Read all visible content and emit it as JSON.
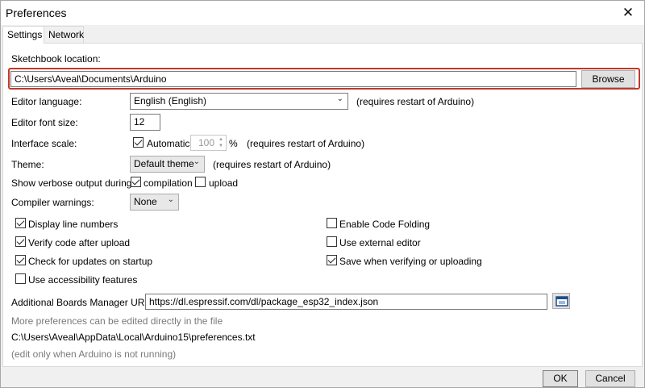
{
  "window": {
    "title": "Preferences",
    "close_glyph": "✕"
  },
  "tabs": [
    {
      "label": "Settings"
    },
    {
      "label": "Network"
    }
  ],
  "sketchbook": {
    "label": "Sketchbook location:",
    "value": "C:\\Users\\Aveal\\Documents\\Arduino",
    "browse_label": "Browse"
  },
  "editor_language": {
    "label": "Editor language:",
    "value": "English (English)",
    "note": "(requires restart of Arduino)"
  },
  "editor_font_size": {
    "label": "Editor font size:",
    "value": "12"
  },
  "interface_scale": {
    "label": "Interface scale:",
    "automatic_label": "Automatic",
    "automatic_checked": true,
    "value": "100",
    "unit": "%",
    "note": "(requires restart of Arduino)"
  },
  "theme": {
    "label": "Theme:",
    "value": "Default theme",
    "note": "(requires restart of Arduino)"
  },
  "verbose": {
    "label": "Show verbose output during:",
    "compilation_label": "compilation",
    "compilation_checked": true,
    "upload_label": "upload",
    "upload_checked": false
  },
  "compiler_warnings": {
    "label": "Compiler warnings:",
    "value": "None"
  },
  "options_left": [
    {
      "label": "Display line numbers",
      "checked": true
    },
    {
      "label": "Verify code after upload",
      "checked": true
    },
    {
      "label": "Check for updates on startup",
      "checked": true
    },
    {
      "label": "Use accessibility features",
      "checked": false
    }
  ],
  "options_right": [
    {
      "label": "Enable Code Folding",
      "checked": false
    },
    {
      "label": "Use external editor",
      "checked": false
    },
    {
      "label": "Save when verifying or uploading",
      "checked": true
    }
  ],
  "boards_manager": {
    "label": "Additional Boards Manager URLs:",
    "value": "https://dl.espressif.com/dl/package_esp32_index.json",
    "icon": "window-list-icon"
  },
  "info": {
    "more_prefs": "More preferences can be edited directly in the file",
    "file_path": "C:\\Users\\Aveal\\AppData\\Local\\Arduino15\\preferences.txt",
    "edit_note": "(edit only when Arduino is not running)"
  },
  "footer": {
    "ok_label": "OK",
    "cancel_label": "Cancel"
  },
  "colors": {
    "highlight": "#c0392b",
    "panel_bg": "#ffffff",
    "window_bg": "#f0f0f0"
  }
}
